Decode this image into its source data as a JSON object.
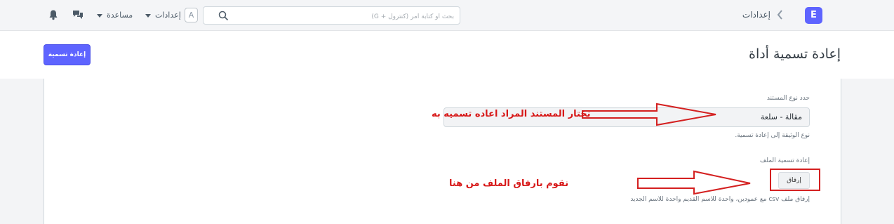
{
  "navbar": {
    "logo_letter": "E",
    "breadcrumb": "إعدادات",
    "search_placeholder": "بحث أو كتابة أمر (كنترول + G)",
    "avatar_letter": "A",
    "settings_menu": "إعدادات",
    "help_menu": "مساعدة",
    "icons": [
      "chevron-left-icon",
      "search-icon",
      "caret-down-icon",
      "chat-icon",
      "bell-icon"
    ]
  },
  "page": {
    "title": "إعادة تسمية أداة",
    "primary_button": "إعادة تسمية"
  },
  "form": {
    "doctype_label": "حدد نوع المستند",
    "doctype_value": "مقالة - سلعة",
    "doctype_description": "نوع الوثيقة إلى إعادة تسمية.",
    "file_label": "إعادة تسمية الملف",
    "attach_button": "إرفاق",
    "file_description": "إرفاق ملف csv مع عمودين، واحدة للاسم القديم واحدة للاسم الجديد"
  },
  "annotations": {
    "select_note": "نختار المستند المراد اعاده تسميه به",
    "attach_note": "نقوم بارفاق الملف من هنا",
    "color": "#d71818"
  },
  "colors": {
    "accent": "#5e64ff",
    "annotation": "#d42020"
  }
}
